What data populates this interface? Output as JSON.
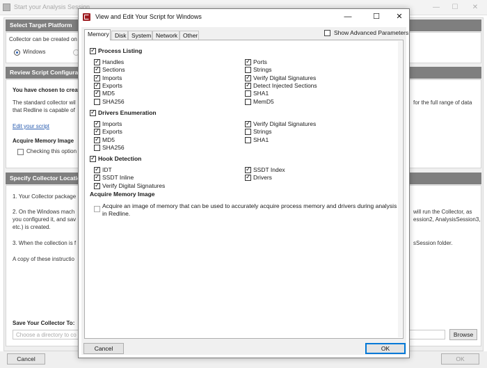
{
  "background": {
    "window_title": "Start your Analysis Session",
    "sections": {
      "target_platform": {
        "header": "Select Target Platform",
        "text": "Collector can be created on",
        "option_windows": "Windows"
      },
      "review_script": {
        "header": "Review Script Configurati",
        "chosen_text": "You have chosen to creat",
        "standard_line1": "The standard collector wil",
        "standard_line2": "that Redline is capable of",
        "right_line1": "for the full range of data",
        "edit_link": "Edit your script",
        "acquire_label": "Acquire Memory Image",
        "checking_text": "Checking this option"
      },
      "collector_location": {
        "header": "Specify Collector Locatio",
        "step1": "1. Your Collector package",
        "step2_line1": "2. On the Windows mach",
        "step2_line2": "you configured it, and sav",
        "step2_line3": "etc.) is created.",
        "step2_right1": "will run the Collector, as",
        "step2_right2": "ession2, AnalysisSession3,",
        "step3": "3. When the collection is f",
        "step3_right": "sSession folder.",
        "copy_text": "A copy of these instructio",
        "save_label": "Save Your Collector To:",
        "path_placeholder": "Choose a directory to co",
        "browse_label": "Browse"
      }
    },
    "footer": {
      "cancel_label": "Cancel",
      "ok_label": "OK"
    }
  },
  "dialog": {
    "title": "View and Edit Your Script for Windows",
    "tabs": [
      "Memory",
      "Disk",
      "System",
      "Network",
      "Other"
    ],
    "active_tab": "Memory",
    "show_advanced_label": "Show Advanced Parameters",
    "process_listing": {
      "label": "Process Listing",
      "checked": true,
      "left": [
        {
          "label": "Handles",
          "checked": true
        },
        {
          "label": "Sections",
          "checked": true
        },
        {
          "label": "Imports",
          "checked": true
        },
        {
          "label": "Exports",
          "checked": true
        },
        {
          "label": "MD5",
          "checked": true
        },
        {
          "label": "SHA256",
          "checked": false
        }
      ],
      "right": [
        {
          "label": "Ports",
          "checked": true
        },
        {
          "label": "Strings",
          "checked": false
        },
        {
          "label": "Verify Digital Signatures",
          "checked": true
        },
        {
          "label": "Detect Injected Sections",
          "checked": true
        },
        {
          "label": "SHA1",
          "checked": false
        },
        {
          "label": "MemD5",
          "checked": false
        }
      ]
    },
    "drivers_enumeration": {
      "label": "Drivers Enumeration",
      "checked": true,
      "left": [
        {
          "label": "Imports",
          "checked": true
        },
        {
          "label": "Exports",
          "checked": true
        },
        {
          "label": "MD5",
          "checked": true
        },
        {
          "label": "SHA256",
          "checked": false
        }
      ],
      "right": [
        {
          "label": "Verify Digital Signatures",
          "checked": true
        },
        {
          "label": "Strings",
          "checked": false
        },
        {
          "label": "SHA1",
          "checked": false
        }
      ]
    },
    "hook_detection": {
      "label": "Hook Detection",
      "checked": true,
      "left": [
        {
          "label": "IDT",
          "checked": true
        },
        {
          "label": "SSDT Inline",
          "checked": true
        },
        {
          "label": "Verify Digital Signatures",
          "checked": true
        }
      ],
      "right": [
        {
          "label": "SSDT Index",
          "checked": true
        },
        {
          "label": "Drivers",
          "checked": true
        }
      ]
    },
    "acquire_memory": {
      "header": "Acquire Memory Image",
      "text": "Acquire an image of memory that can be used to accurately acquire process memory and drivers during analysis in Redline.",
      "checked": false
    },
    "cancel_label": "Cancel",
    "ok_label": "OK"
  }
}
